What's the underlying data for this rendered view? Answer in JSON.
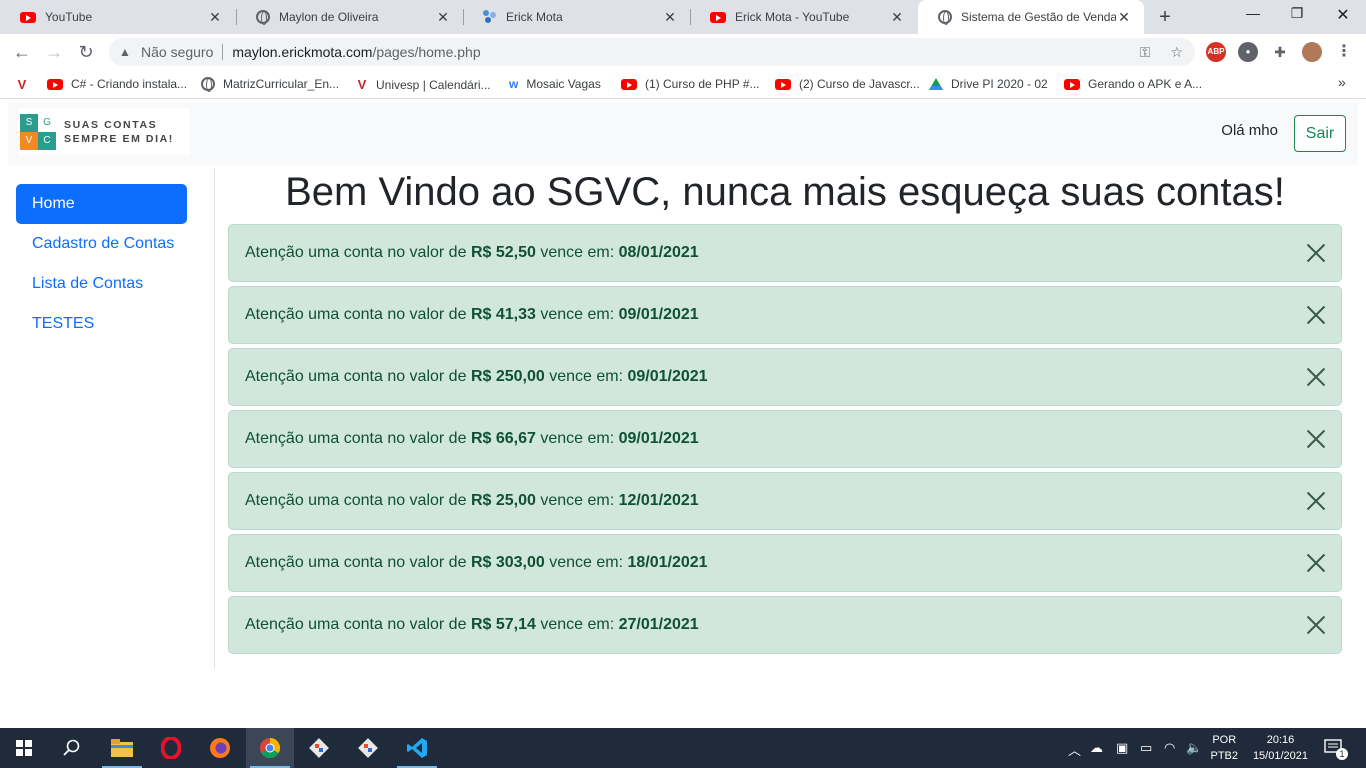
{
  "browser": {
    "tabs": [
      {
        "title": "YouTube",
        "icon": "youtube-icon"
      },
      {
        "title": "Maylon de Oliveira",
        "icon": "globe-icon"
      },
      {
        "title": "Erick Mota",
        "icon": "app-icon"
      },
      {
        "title": "Erick Mota - YouTube",
        "icon": "youtube-icon"
      },
      {
        "title": "Sistema de Gestão de Vendas d",
        "icon": "globe-icon",
        "active": true
      }
    ],
    "address": {
      "security": "Não seguro",
      "host": "maylon.erickmota.com",
      "path": "/pages/home.php"
    },
    "extension_abp": "ABP",
    "bookmarks": [
      {
        "label": "",
        "icon": "v-icon"
      },
      {
        "label": "C# - Criando instala...",
        "icon": "youtube-icon"
      },
      {
        "label": "MatrizCurricular_En...",
        "icon": "globe-icon"
      },
      {
        "label": "Univesp | Calendári...",
        "icon": "v-icon"
      },
      {
        "label": "Mosaic Vagas",
        "icon": "w-icon"
      },
      {
        "label": "(1) Curso de PHP #...",
        "icon": "youtube-icon"
      },
      {
        "label": "(2) Curso de Javascr...",
        "icon": "youtube-icon"
      },
      {
        "label": "Drive PI 2020 - 02",
        "icon": "drive-icon"
      },
      {
        "label": "Gerando o APK e A...",
        "icon": "youtube-icon"
      }
    ],
    "bookmarks_overflow": "»"
  },
  "app": {
    "logo": {
      "letters": [
        "S",
        "G",
        "V",
        "C"
      ],
      "line1": "SUAS CONTAS",
      "line2": "SEMPRE EM DIA!",
      "colors": [
        "#2a9d8f",
        "#ffffff",
        "#f08a24",
        "#2a9d8f"
      ]
    },
    "greeting": "Olá mho",
    "logout_label": "Sair",
    "sidebar": [
      {
        "label": "Home",
        "active": true
      },
      {
        "label": "Cadastro de Contas"
      },
      {
        "label": "Lista de Contas"
      },
      {
        "label": "TESTES"
      }
    ],
    "title": "Bem Vindo ao SGVC, nunca mais esqueça suas contas!",
    "alert_prefix": "Atenção uma conta no valor de",
    "alert_middle": "vence em:",
    "alerts": [
      {
        "value": "R$ 52,50",
        "date": "08/01/2021"
      },
      {
        "value": "R$ 41,33",
        "date": "09/01/2021"
      },
      {
        "value": "R$ 250,00",
        "date": "09/01/2021"
      },
      {
        "value": "R$ 66,67",
        "date": "09/01/2021"
      },
      {
        "value": "R$ 25,00",
        "date": "12/01/2021"
      },
      {
        "value": "R$ 303,00",
        "date": "18/01/2021"
      },
      {
        "value": "R$ 57,14",
        "date": "27/01/2021"
      }
    ],
    "colors": {
      "primary": "#0d6efd",
      "success": "#198754",
      "alert_bg": "#d1e7dd",
      "alert_text": "#0f5132"
    }
  },
  "taskbar": {
    "apps": [
      "start-icon",
      "search-icon",
      "file-explorer-icon",
      "opera-icon",
      "firefox-icon",
      "chrome-icon",
      "git-icon",
      "git-icon",
      "vscode-icon"
    ],
    "lang_line1": "POR",
    "lang_line2": "PTB2",
    "time": "20:16",
    "date": "15/01/2021",
    "notification_count": "1"
  }
}
